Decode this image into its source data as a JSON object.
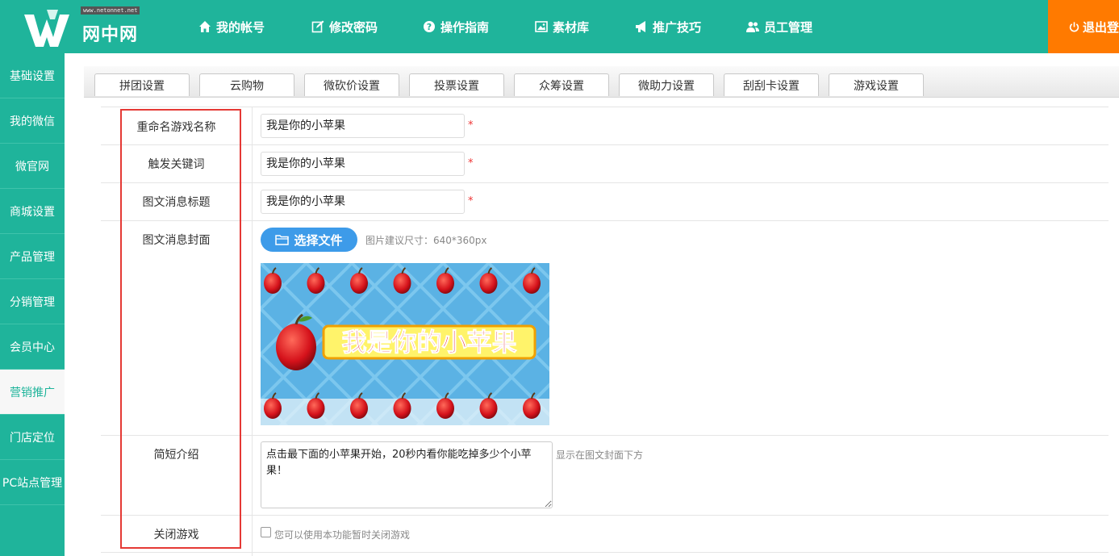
{
  "header": {
    "logo_url": "www.netonnet.net",
    "logo_text": "网中网",
    "nav": [
      {
        "label": "我的帐号",
        "icon": "home-icon"
      },
      {
        "label": "修改密码",
        "icon": "edit-icon"
      },
      {
        "label": "操作指南",
        "icon": "help-icon"
      },
      {
        "label": "素材库",
        "icon": "image-icon"
      },
      {
        "label": "推广技巧",
        "icon": "megaphone-icon"
      },
      {
        "label": "员工管理",
        "icon": "users-icon"
      }
    ],
    "logout_label": "退出登"
  },
  "sidebar": {
    "items": [
      {
        "label": "基础设置"
      },
      {
        "label": "我的微信"
      },
      {
        "label": "微官网"
      },
      {
        "label": "商城设置"
      },
      {
        "label": "产品管理"
      },
      {
        "label": "分销管理"
      },
      {
        "label": "会员中心"
      },
      {
        "label": "营销推广",
        "active": true
      },
      {
        "label": "门店定位"
      },
      {
        "label": "PC站点管理"
      }
    ]
  },
  "tabs": [
    {
      "label": "拼团设置"
    },
    {
      "label": "云购物"
    },
    {
      "label": "微砍价设置"
    },
    {
      "label": "投票设置"
    },
    {
      "label": "众筹设置"
    },
    {
      "label": "微助力设置"
    },
    {
      "label": "刮刮卡设置"
    },
    {
      "label": "游戏设置"
    }
  ],
  "form": {
    "rename": {
      "label": "重命名游戏名称",
      "value": "我是你的小苹果",
      "required": "*"
    },
    "keyword": {
      "label": "触发关键词",
      "value": "我是你的小苹果",
      "required": "*"
    },
    "msg_title": {
      "label": "图文消息标题",
      "value": "我是你的小苹果",
      "required": "*"
    },
    "cover": {
      "label": "图文消息封面",
      "button_label": "选择文件",
      "hint": "图片建议尺寸：640*360px",
      "image_text": "我是你的小苹果"
    },
    "intro": {
      "label": "简短介绍",
      "value": "点击最下面的小苹果开始，20秒内看你能吃掉多少个小苹果！",
      "hint": "显示在图文封面下方"
    },
    "close": {
      "label": "关闭游戏",
      "checkbox_label": "您可以使用本功能暂时关闭游戏",
      "checked": false
    }
  },
  "colors": {
    "primary": "#1fb49b",
    "logout": "#ff7a00",
    "button": "#3d9be9",
    "highlight": "#e53935"
  }
}
